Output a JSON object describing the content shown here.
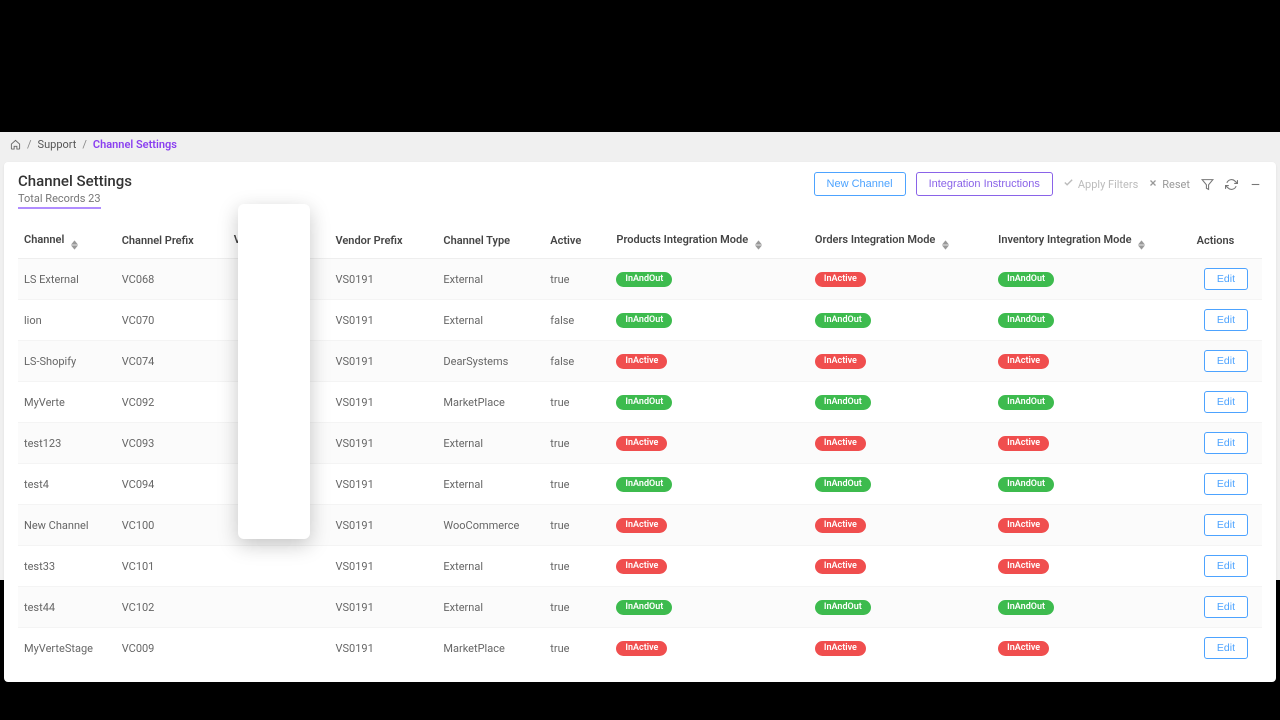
{
  "breadcrumb": {
    "support": "Support",
    "current": "Channel Settings"
  },
  "header": {
    "title": "Channel Settings",
    "subtitle": "Total Records 23",
    "new_channel": "New Channel",
    "integration_instructions": "Integration Instructions",
    "apply_filters": "Apply Filters",
    "reset": "Reset"
  },
  "columns": {
    "channel": "Channel",
    "channel_prefix": "Channel Prefix",
    "vendor": "Vendor",
    "vendor_prefix": "Vendor Prefix",
    "channel_type": "Channel Type",
    "active": "Active",
    "products_mode": "Products Integration Mode",
    "orders_mode": "Orders Integration Mode",
    "inventory_mode": "Inventory Integration Mode",
    "actions": "Actions"
  },
  "badges": {
    "inandout": "InAndOut",
    "inactive": "InActive"
  },
  "action_label": "Edit",
  "rows": [
    {
      "channel": "LS External",
      "channel_prefix": "VC068",
      "vendor": "",
      "vendor_prefix": "VS0191",
      "channel_type": "External",
      "active": "true",
      "products": "inandout",
      "orders": "inactive",
      "inventory": "inandout"
    },
    {
      "channel": "lion",
      "channel_prefix": "VC070",
      "vendor": "",
      "vendor_prefix": "VS0191",
      "channel_type": "External",
      "active": "false",
      "products": "inandout",
      "orders": "inandout",
      "inventory": "inandout"
    },
    {
      "channel": "LS-Shopify",
      "channel_prefix": "VC074",
      "vendor": "",
      "vendor_prefix": "VS0191",
      "channel_type": "DearSystems",
      "active": "false",
      "products": "inactive",
      "orders": "inactive",
      "inventory": "inactive"
    },
    {
      "channel": "MyVerte",
      "channel_prefix": "VC092",
      "vendor": "",
      "vendor_prefix": "VS0191",
      "channel_type": "MarketPlace",
      "active": "true",
      "products": "inandout",
      "orders": "inandout",
      "inventory": "inandout"
    },
    {
      "channel": "test123",
      "channel_prefix": "VC093",
      "vendor": "",
      "vendor_prefix": "VS0191",
      "channel_type": "External",
      "active": "true",
      "products": "inactive",
      "orders": "inactive",
      "inventory": "inactive"
    },
    {
      "channel": "test4",
      "channel_prefix": "VC094",
      "vendor": "",
      "vendor_prefix": "VS0191",
      "channel_type": "External",
      "active": "true",
      "products": "inandout",
      "orders": "inandout",
      "inventory": "inandout"
    },
    {
      "channel": "New Channel",
      "channel_prefix": "VC100",
      "vendor": "",
      "vendor_prefix": "VS0191",
      "channel_type": "WooCommerce",
      "active": "true",
      "products": "inactive",
      "orders": "inactive",
      "inventory": "inactive"
    },
    {
      "channel": "test33",
      "channel_prefix": "VC101",
      "vendor": "",
      "vendor_prefix": "VS0191",
      "channel_type": "External",
      "active": "true",
      "products": "inactive",
      "orders": "inactive",
      "inventory": "inactive"
    },
    {
      "channel": "test44",
      "channel_prefix": "VC102",
      "vendor": "",
      "vendor_prefix": "VS0191",
      "channel_type": "External",
      "active": "true",
      "products": "inandout",
      "orders": "inandout",
      "inventory": "inandout"
    },
    {
      "channel": "MyVerteStage",
      "channel_prefix": "VC009",
      "vendor": "",
      "vendor_prefix": "VS0191",
      "channel_type": "MarketPlace",
      "active": "true",
      "products": "inactive",
      "orders": "inactive",
      "inventory": "inactive"
    }
  ]
}
